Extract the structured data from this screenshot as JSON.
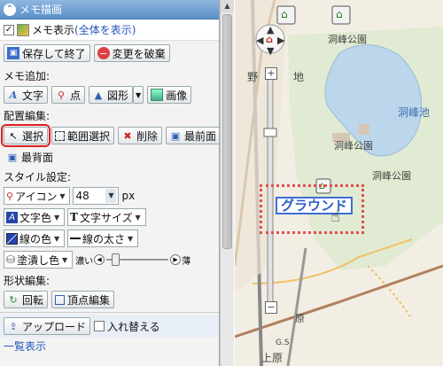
{
  "panel": {
    "title": "メモ描画",
    "memo_display": {
      "label": "メモ表示",
      "link": "(全体を表示)",
      "checked": true
    },
    "save_button": "保存して終了",
    "discard_button": "変更を破棄",
    "memo_add": {
      "label": "メモ追加:",
      "text": "文字",
      "point": "点",
      "shape": "図形",
      "image": "画像"
    },
    "arrange": {
      "label": "配置編集:",
      "select": "選択",
      "range_select": "範囲選択",
      "delete": "削除",
      "front": "最前面",
      "back": "最背面"
    },
    "style": {
      "label": "スタイル設定:",
      "icon": "アイコン",
      "size_value": "48",
      "size_unit": "px",
      "text_color": "文字色",
      "text_size": "文字サイズ",
      "line_color": "線の色",
      "line_width": "線の太さ",
      "fill_color": "塗潰し色",
      "dark_label": "濃い",
      "light_label": "薄",
      "opacity_level": 0.1
    },
    "shape_edit": {
      "label": "形状編集:",
      "rotate": "回転",
      "vertex": "頂点編集"
    },
    "upload": "アップロード",
    "swap": {
      "label": "入れ替える",
      "checked": false
    },
    "list": "一覧表示"
  },
  "map": {
    "labels": {
      "park_top": "洞峰公園",
      "noda": "野",
      "danchi": "地",
      "pond": "洞峰池",
      "park_mid": "洞峰公園",
      "park_right": "洞峰公園",
      "nihara": "原",
      "uehara": "上原",
      "uehara2": "上原",
      "gs": "G.S"
    },
    "ground_label": "グラウンド"
  },
  "colors": {
    "accent": "#5a8fc7",
    "highlight": "#e02020",
    "pond": "#bcd6ec",
    "park": "#d9e8c5"
  }
}
